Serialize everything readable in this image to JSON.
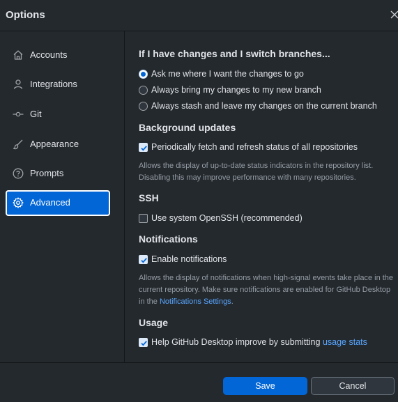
{
  "window": {
    "title": "Options"
  },
  "sidebar": {
    "items": [
      {
        "label": "Accounts",
        "icon": "home-icon"
      },
      {
        "label": "Integrations",
        "icon": "person-icon"
      },
      {
        "label": "Git",
        "icon": "git-commit-icon"
      },
      {
        "label": "Appearance",
        "icon": "paintbrush-icon"
      },
      {
        "label": "Prompts",
        "icon": "question-icon"
      },
      {
        "label": "Advanced",
        "icon": "gear-icon",
        "selected": true
      }
    ]
  },
  "advanced": {
    "switch_branches": {
      "heading": "If I have changes and I switch branches...",
      "options": [
        {
          "label": "Ask me where I want the changes to go",
          "selected": true
        },
        {
          "label": "Always bring my changes to my new branch",
          "selected": false
        },
        {
          "label": "Always stash and leave my changes on the current branch",
          "selected": false
        }
      ]
    },
    "background": {
      "heading": "Background updates",
      "checkbox_label": "Periodically fetch and refresh status of all repositories",
      "checked": true,
      "description": "Allows the display of up-to-date status indicators in the repository list. Disabling this may improve performance with many repositories."
    },
    "ssh": {
      "heading": "SSH",
      "checkbox_label": "Use system OpenSSH (recommended)",
      "checked": false
    },
    "notifications": {
      "heading": "Notifications",
      "checkbox_label": "Enable notifications",
      "checked": true,
      "description_prefix": "Allows the display of notifications when high-signal events take place in the current repository. Make sure notifications are enabled for GitHub Desktop in the ",
      "description_link": "Notifications Settings",
      "description_suffix": "."
    },
    "usage": {
      "heading": "Usage",
      "checkbox_label": "Help GitHub Desktop improve by submitting ",
      "checkbox_link": "usage stats",
      "checked": true
    }
  },
  "footer": {
    "save_label": "Save",
    "cancel_label": "Cancel"
  },
  "colors": {
    "accent": "#0366d6",
    "background": "#24292e",
    "link": "#58a6ff"
  }
}
